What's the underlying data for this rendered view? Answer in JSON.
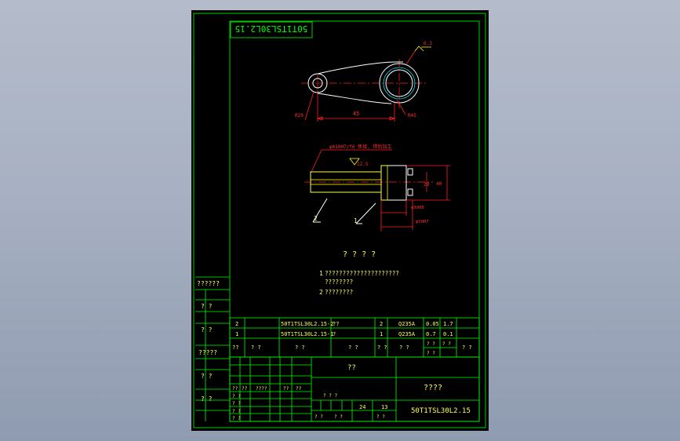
{
  "drawing_number": "50T1TSL30L2.15",
  "drawing_number_mirrored": "50T1TSL30L2.15",
  "top_view": {
    "dim_length": "45",
    "dim_left_radius": "R20",
    "dim_right_radius": "R45",
    "surface_symbol": "6.3"
  },
  "section_view": {
    "weld_note": "φ010H7/f6 焦接, 焊后加工",
    "roughness": "12.5",
    "dim_bore": "φ018H7",
    "dim_outer": "φ020f6",
    "dim_right_1": "20",
    "dim_right_2": "40",
    "dim_bottom": "φ30H8",
    "dim_bottom_2": "φ50H7",
    "leader_1": "1",
    "leader_2": "2"
  },
  "notes": {
    "title": "? ? ? ?",
    "item1_num": "1",
    "item1_text": "?????????????????????",
    "item1_cont": "????????",
    "item2_num": "2",
    "item2_text": "????????"
  },
  "side_labels": [
    "??????",
    "? ?",
    "? ?",
    "?????",
    "? ?",
    "? ?"
  ],
  "parts_list": [
    {
      "seq": "2",
      "code": "50T1TSL30L2.15-2",
      "name": "??",
      "qty": "2",
      "material": "Q235A",
      "weight": "0.05",
      "total": "1.7"
    },
    {
      "seq": "1",
      "code": "50T1TSL30L2.15-1",
      "name": "?",
      "qty": "1",
      "material": "Q235A",
      "weight": "0.7",
      "total": "0.1"
    }
  ],
  "parts_header": [
    "??",
    "? ?",
    "? ?",
    "? ?",
    "? ?",
    "? ?",
    "? ?"
  ],
  "parts_header_extra": [
    "? ?",
    "? ?",
    "? ?"
  ],
  "title_block": {
    "material_cell": "??",
    "drawing_title": "????",
    "drawing_code": "50T1TSL30L2.15",
    "scale": "24",
    "sheets": "13",
    "row_labels": [
      "??",
      "??",
      "????",
      "??",
      "??"
    ],
    "row_labels_2": [
      "? ?",
      "? ?",
      "? ?",
      "? ?"
    ],
    "stage_label": "? ? ?",
    "stage_cells": [
      "? ?",
      "? ?",
      "? ?"
    ]
  },
  "colors": {
    "border": "#00ff00",
    "dimension": "#ff2020",
    "outline": "#ffffff",
    "center": "#ff2020",
    "hatch": "#ffff00",
    "text": "#ffff55",
    "background": "#000000"
  }
}
